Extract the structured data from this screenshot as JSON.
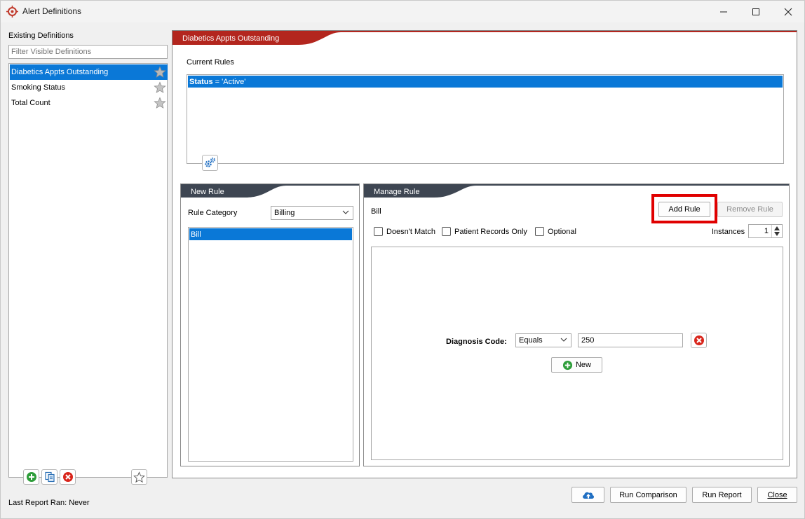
{
  "window": {
    "title": "Alert Definitions"
  },
  "left": {
    "heading": "Existing Definitions",
    "filter_placeholder": "Filter Visible Definitions",
    "definitions": [
      {
        "label": "Diabetics Appts Outstanding"
      },
      {
        "label": "Smoking Status"
      },
      {
        "label": "Total Count"
      }
    ],
    "last_report": "Last Report Ran: Never"
  },
  "main": {
    "tab_title": "Diabetics Appts Outstanding",
    "current_rules_label": "Current Rules",
    "rule_field": "Status",
    "rule_rest": " = 'Active'"
  },
  "new_rule": {
    "tab_title": "New Rule",
    "category_label": "Rule Category",
    "category_value": "Billing",
    "items": [
      "Bill"
    ]
  },
  "manage_rule": {
    "tab_title": "Manage Rule",
    "selected_label": "Bill",
    "add_button": "Add Rule",
    "remove_button": "Remove Rule",
    "checkboxes": [
      "Doesn't Match",
      "Patient Records Only",
      "Optional"
    ],
    "instances_label": "Instances",
    "instances_value": "1",
    "condition_label": "Diagnosis Code:",
    "operator": "Equals",
    "value": "250",
    "new_button": "New"
  },
  "footer": {
    "run_comparison": "Run Comparison",
    "run_report": "Run Report",
    "close": "Close"
  },
  "colors": {
    "accent_red": "#b3261e",
    "tab_dark": "#3e4652",
    "selection_blue": "#0a78d7"
  }
}
